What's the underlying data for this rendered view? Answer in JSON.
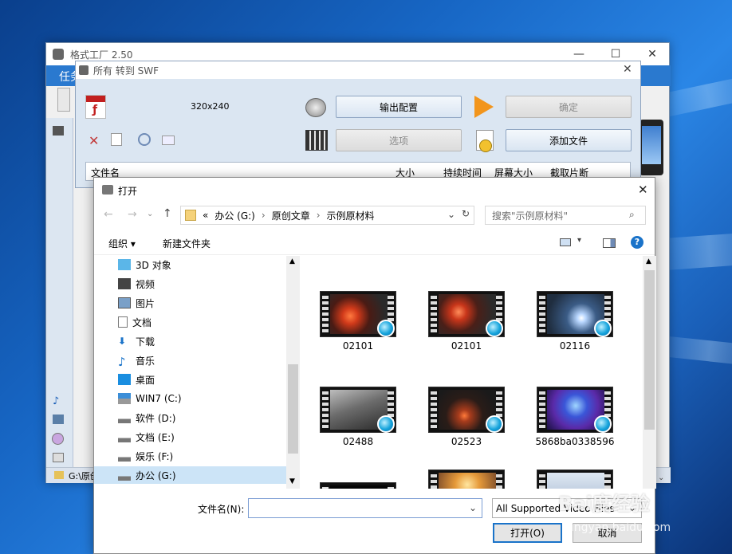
{
  "main_window": {
    "title": "格式工厂 2.50",
    "menu_first": "任务",
    "statusbar_path": "G:\\原创"
  },
  "swf_window": {
    "title": "所有 转到 SWF",
    "resolution": "320x240",
    "output_config_label": "输出配置",
    "ok_label": "确定",
    "options_label": "选项",
    "add_file_label": "添加文件",
    "columns": [
      "文件名",
      "大小",
      "持续时间",
      "屏幕大小",
      "截取片断"
    ]
  },
  "open_dialog": {
    "title": "打开",
    "breadcrumb": [
      "«",
      "办公 (G:)",
      "原创文章",
      "示例原材料"
    ],
    "search_placeholder": "搜索\"示例原材料\"",
    "organize_label": "组织",
    "new_folder_label": "新建文件夹",
    "nav_items": [
      "3D 对象",
      "视频",
      "图片",
      "文档",
      "下载",
      "音乐",
      "桌面",
      "WIN7 (C:)",
      "软件 (D:)",
      "文档 (E:)",
      "娱乐 (F:)",
      "办公 (G:)"
    ],
    "selected_nav": "办公 (G:)",
    "files": [
      "02101",
      "02101",
      "02116",
      "02488",
      "02523",
      "5868ba0338596"
    ],
    "filename_label": "文件名(N):",
    "filename_value": "",
    "filetype_value": "All Supported Video Files",
    "open_button": "打开(O)",
    "cancel_button": "取消"
  },
  "watermark": {
    "text": "Bai度经验",
    "sub": "jingyan.baidu.com"
  },
  "colors": {
    "accent": "#1a73c9",
    "selected": "#cce4f7",
    "help": "#1a73c9"
  }
}
